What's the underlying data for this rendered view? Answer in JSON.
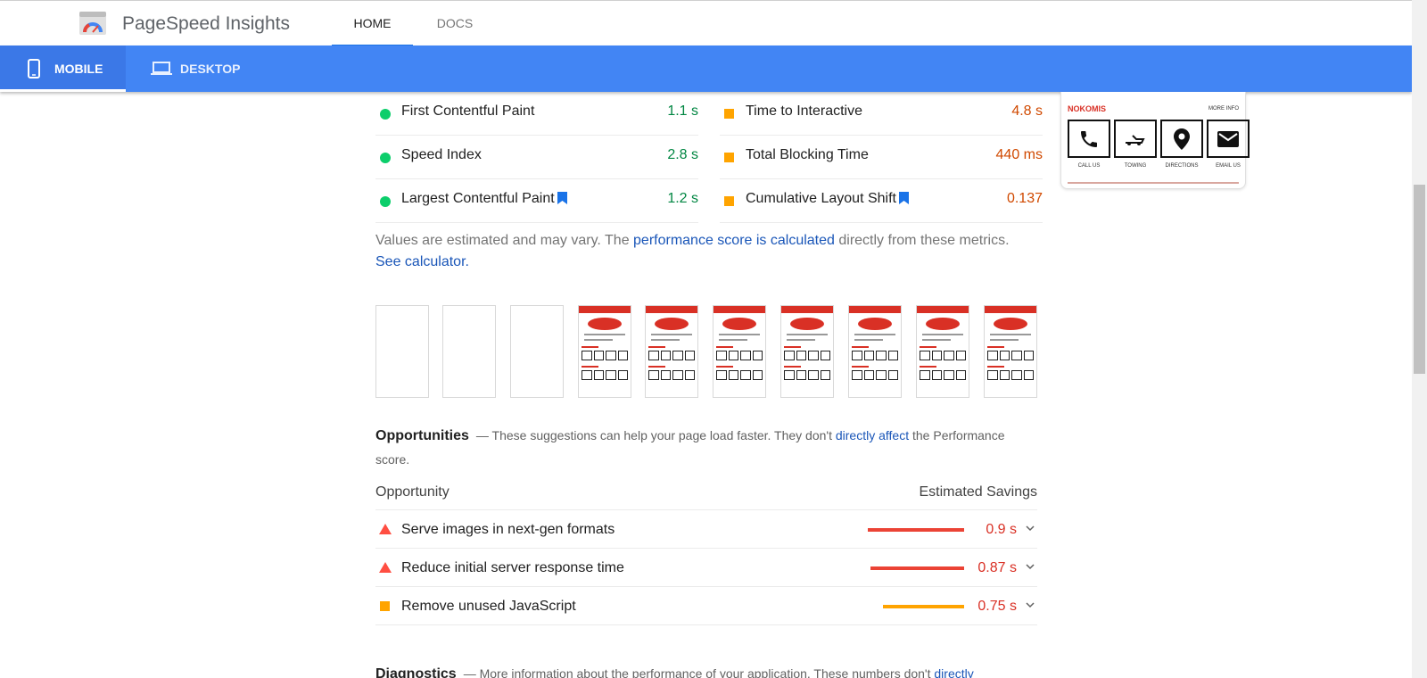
{
  "header": {
    "app_title": "PageSpeed Insights",
    "tabs": [
      "HOME",
      "DOCS"
    ]
  },
  "device_tabs": {
    "mobile": "MOBILE",
    "desktop": "DESKTOP"
  },
  "metrics": [
    {
      "name": "First Contentful Paint",
      "value": "1.1 s",
      "status": "good"
    },
    {
      "name": "Time to Interactive",
      "value": "4.8 s",
      "status": "average"
    },
    {
      "name": "Speed Index",
      "value": "2.8 s",
      "status": "good"
    },
    {
      "name": "Total Blocking Time",
      "value": "440 ms",
      "status": "average"
    },
    {
      "name": "Largest Contentful Paint",
      "value": "1.2 s",
      "status": "good"
    },
    {
      "name": "Cumulative Layout Shift",
      "value": "0.137",
      "status": "average"
    }
  ],
  "disclaimer": {
    "part1": "Values are estimated and may vary. The ",
    "link1": "performance score is calculated",
    "part2": " directly from these metrics. ",
    "link2": "See calculator."
  },
  "opportunities": {
    "title": "Opportunities",
    "desc_part1": "— These suggestions can help your page load faster. They don't ",
    "desc_link": "directly affect",
    "desc_part2": " the Performance score.",
    "col_opportunity": "Opportunity",
    "col_savings": "Estimated Savings",
    "items": [
      {
        "label": "Serve images in next-gen formats",
        "savings": "0.9 s",
        "severity": "fail",
        "bar_fraction": 1.0
      },
      {
        "label": "Reduce initial server response time",
        "savings": "0.87 s",
        "severity": "fail",
        "bar_fraction": 0.97
      },
      {
        "label": "Remove unused JavaScript",
        "savings": "0.75 s",
        "severity": "average",
        "bar_fraction": 0.84
      }
    ]
  },
  "diagnostics": {
    "title": "Diagnostics",
    "desc_part1": "— More information about the performance of your application. These numbers don't ",
    "desc_link": "directly"
  },
  "preview": {
    "name": "NOKOMIS",
    "more": "MORE INFO",
    "buttons": [
      "CALL US",
      "TOWING",
      "DIRECTIONS",
      "EMAIL US"
    ]
  },
  "colors": {
    "brand_blue": "#4285f4",
    "good": "#0cce6b",
    "average": "#ffa400",
    "fail": "#ff4e42",
    "link": "#1a56b8"
  }
}
